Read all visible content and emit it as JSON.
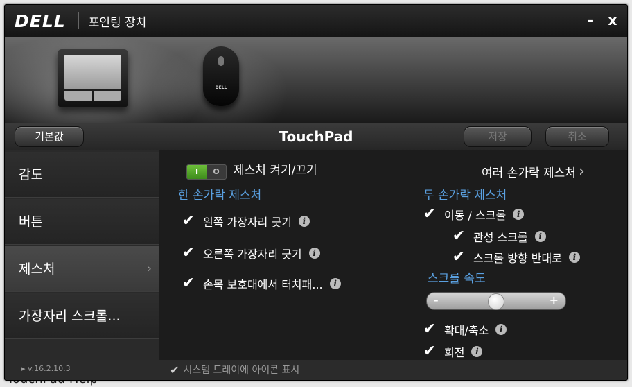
{
  "background": {
    "text": "TouchPad Help"
  },
  "window": {
    "brand": "DELL",
    "title": "포인팅 장치",
    "minimize": "–",
    "close": "x"
  },
  "banner": {
    "device_brand": "DELL"
  },
  "toolbar": {
    "defaults_label": "기본값",
    "title": "TouchPad",
    "save_label": "저장",
    "cancel_label": "취소"
  },
  "sidebar": {
    "items": [
      {
        "label": "감도"
      },
      {
        "label": "버튼"
      },
      {
        "label": "제스처"
      },
      {
        "label": "가장자리 스크롤..."
      }
    ],
    "active_chevron": "›"
  },
  "main": {
    "gesture_toggle_label": "제스처 켜기/끄기",
    "toggle_on": "I",
    "toggle_off": "O",
    "multi_finger_link": "여러 손가락 제스처",
    "link_chevron": "›",
    "one_finger": {
      "title": "한 손가락 제스처",
      "items": [
        {
          "label": "왼쪽 가장자리 긋기",
          "checked": true
        },
        {
          "label": "오른쪽 가장자리 긋기",
          "checked": true
        },
        {
          "label": "손목 보호대에서 터치패...",
          "checked": true
        }
      ]
    },
    "two_finger": {
      "title": "두 손가락 제스처",
      "items": [
        {
          "label": "이동 / 스크롤",
          "checked": true
        },
        {
          "label": "관성 스크롤",
          "checked": true
        },
        {
          "label": "스크롤 방향 반대로",
          "checked": true
        }
      ],
      "scroll_speed_title": "스크롤 속도",
      "slider_minus": "-",
      "slider_plus": "+",
      "scroll_speed_value": 0.5,
      "zoom_label": "확대/축소",
      "rotate_label": "회전"
    }
  },
  "footer": {
    "version": "▸ v.16.2.10.3",
    "tray_label": "시스템 트레이에 아이콘 표시",
    "tray_checked": true
  },
  "colors": {
    "accent": "#5aa0e0",
    "toggle_on": "#4fa52a"
  },
  "icons": {
    "check": "✔",
    "info": "i"
  }
}
